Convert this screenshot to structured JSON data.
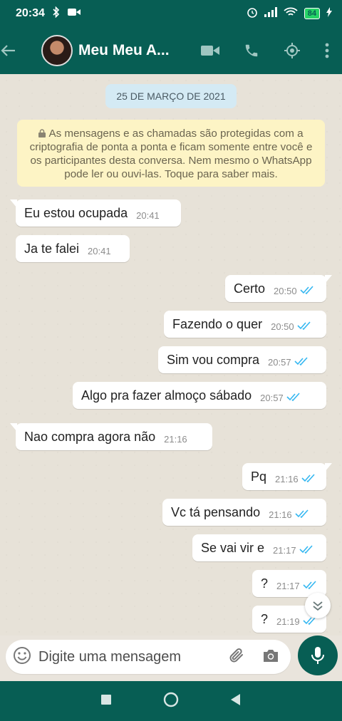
{
  "status": {
    "time": "20:34",
    "battery": "84"
  },
  "header": {
    "title": "Meu Meu A..."
  },
  "chat": {
    "date": "25 DE MARÇO DE 2021",
    "notice": "As mensagens e as chamadas são protegidas com a criptografia de ponta a ponta e ficam somente entre você e os participantes desta conversa. Nem mesmo o WhatsApp pode ler ou ouvi-las. Toque para saber mais.",
    "messages": [
      {
        "text": "Eu estou ocupada",
        "time": "20:41",
        "dir": "in"
      },
      {
        "text": "Ja te falei",
        "time": "20:41",
        "dir": "in"
      },
      {
        "text": "Certo",
        "time": "20:50",
        "dir": "out"
      },
      {
        "text": "Fazendo o quer",
        "time": "20:50",
        "dir": "out"
      },
      {
        "text": "Sim vou compra",
        "time": "20:57",
        "dir": "out"
      },
      {
        "text": "Algo pra fazer almoço sábado",
        "time": "20:57",
        "dir": "out"
      },
      {
        "text": "Nao compra agora não",
        "time": "21:16",
        "dir": "in"
      },
      {
        "text": "Pq",
        "time": "21:16",
        "dir": "out"
      },
      {
        "text": "Vc tá pensando",
        "time": "21:16",
        "dir": "out"
      },
      {
        "text": "Se vai vir e",
        "time": "21:17",
        "dir": "out"
      },
      {
        "text": "?",
        "time": "21:17",
        "dir": "out"
      },
      {
        "text": "?",
        "time": "21:19",
        "dir": "out"
      }
    ]
  },
  "composer": {
    "placeholder": "Digite uma mensagem"
  },
  "colors": {
    "primary": "#075e54",
    "read_tick": "#34b7f1",
    "notice_bg": "#fdf4c5",
    "date_bg": "#d4eaf4"
  }
}
